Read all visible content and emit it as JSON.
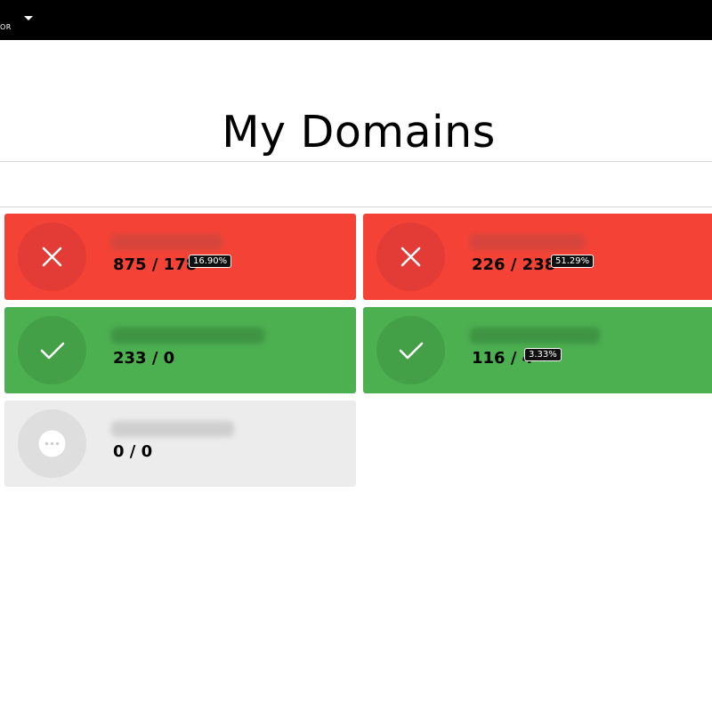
{
  "topbar": {
    "label": "OR",
    "background": "#000000"
  },
  "page": {
    "title": "My Domains"
  },
  "colors": {
    "error": "#f44336",
    "ok": "#4caf50",
    "pending": "#ececec"
  },
  "domains": [
    {
      "status": "error",
      "icon": "close-icon",
      "count": "875 / 178",
      "percent": "16.90%"
    },
    {
      "status": "error",
      "icon": "close-icon",
      "count": "226 / 238",
      "percent": "51.29%"
    },
    {
      "status": "ok",
      "icon": "check-icon",
      "count": "233 / 0",
      "percent": ""
    },
    {
      "status": "ok",
      "icon": "check-icon",
      "count": "116 / 4",
      "percent": "3.33%"
    },
    {
      "status": "pending",
      "icon": "more-icon",
      "count": "0 / 0",
      "percent": ""
    }
  ]
}
